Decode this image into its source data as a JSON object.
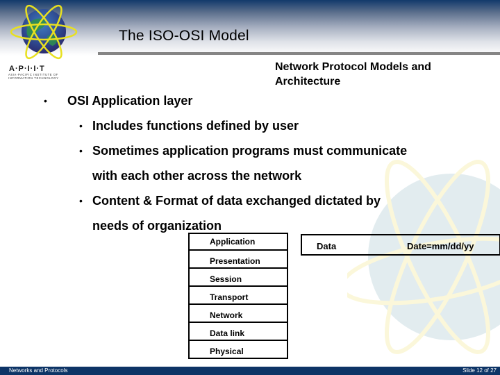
{
  "header": {
    "title": "The ISO-OSI Model",
    "subtitle_line1": "Network Protocol Models and",
    "subtitle_line2": "Architecture"
  },
  "logo": {
    "icon": "atom-globe-icon",
    "wordmark": "A·P·I·I·T",
    "tagline_line1": "Asia-Pacific Institute of",
    "tagline_line2": "Information Technology"
  },
  "content": {
    "bullet": "•",
    "heading": "OSI Application layer",
    "items": [
      {
        "line1": "Includes functions defined by user",
        "line2": ""
      },
      {
        "line1": "Sometimes application programs must communicate",
        "line2": "with each other across the network"
      },
      {
        "line1": "Content & Format of data exchanged dictated by",
        "line2": "needs of organization"
      }
    ]
  },
  "osi_stack": {
    "layers": [
      "Application",
      "Presentation",
      "Session",
      "Transport",
      "Network",
      "Data link",
      "Physical"
    ]
  },
  "data_box": {
    "label": "Data",
    "value": "Date=mm/dd/yy"
  },
  "footer": {
    "left": "Networks and Protocols",
    "right": "Slide 12 of 27"
  },
  "colors": {
    "header_dark": "#123a6b",
    "title_rule": "#858585",
    "footer_bg": "#0d3466"
  }
}
